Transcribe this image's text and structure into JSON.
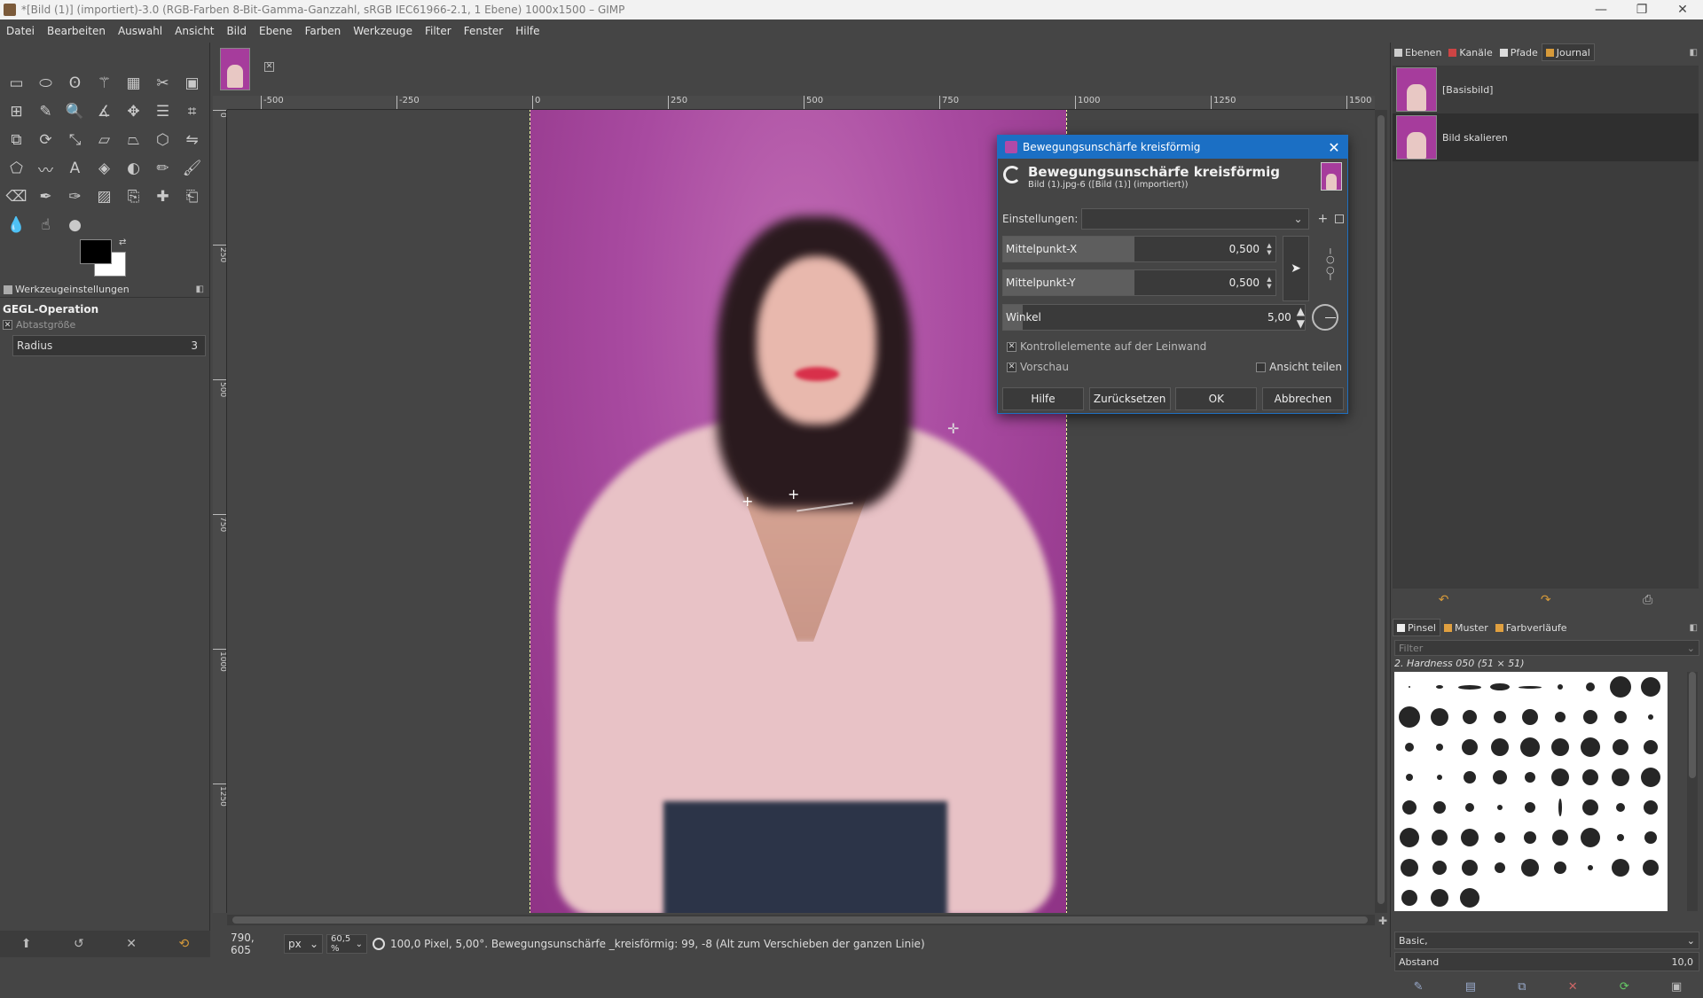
{
  "window": {
    "title": "*[Bild (1)] (importiert)-3.0 (RGB-Farben 8-Bit-Gamma-Ganzzahl, sRGB IEC61966-2.1, 1 Ebene) 1000x1500 – GIMP",
    "minimize": "—",
    "maximize": "❐",
    "close": "✕"
  },
  "menu": [
    "Datei",
    "Bearbeiten",
    "Auswahl",
    "Ansicht",
    "Bild",
    "Ebene",
    "Farben",
    "Werkzeuge",
    "Filter",
    "Fenster",
    "Hilfe"
  ],
  "toolbox": {
    "rows": [
      [
        "rect-select-icon",
        "ellipse-select-icon",
        "lasso-icon",
        "magic-wand-icon",
        "select-by-color-icon",
        "scissors-select-icon",
        "foreground-select-icon"
      ],
      [
        "align-icon",
        "paths-edit-icon",
        "zoom-icon",
        "measure-icon",
        "move-icon",
        "align-distribute-icon",
        "crop-icon"
      ],
      [
        "unified-transform-icon",
        "rotate-icon",
        "scale-icon",
        "shear-icon",
        "perspective-icon",
        "3d-transform-icon",
        "flip-icon"
      ],
      [
        "cage-icon",
        "warp-icon",
        "text-icon",
        "bucket-fill-icon",
        "gradient-icon",
        "pencil-icon",
        "paintbrush-icon"
      ],
      [
        "eraser-icon",
        "airbrush-icon",
        "ink-icon",
        "mypaint-icon",
        "clone-icon",
        "heal-icon",
        "perspective-clone-icon"
      ],
      [
        "blur-icon",
        "smudge-icon",
        "dodge-burn-icon"
      ]
    ],
    "glyphs": {
      "rect-select-icon": "▭",
      "ellipse-select-icon": "⬭",
      "lasso-icon": "ʘ",
      "magic-wand-icon": "⚚",
      "select-by-color-icon": "▦",
      "scissors-select-icon": "✂",
      "foreground-select-icon": "▣",
      "align-icon": "⊞",
      "paths-edit-icon": "✎",
      "zoom-icon": "🔍",
      "measure-icon": "∡",
      "move-icon": "✥",
      "align-distribute-icon": "☰",
      "crop-icon": "⌗",
      "unified-transform-icon": "⧉",
      "rotate-icon": "⟳",
      "scale-icon": "⤡",
      "shear-icon": "▱",
      "perspective-icon": "⏢",
      "3d-transform-icon": "⬡",
      "flip-icon": "⇋",
      "cage-icon": "⬠",
      "warp-icon": "〰",
      "text-icon": "A",
      "bucket-fill-icon": "◈",
      "gradient-icon": "◐",
      "pencil-icon": "✏",
      "paintbrush-icon": "🖌",
      "eraser-icon": "⌫",
      "airbrush-icon": "✒",
      "ink-icon": "✑",
      "mypaint-icon": "▨",
      "clone-icon": "⎘",
      "heal-icon": "✚",
      "perspective-clone-icon": "⎗",
      "blur-icon": "💧",
      "smudge-icon": "☝",
      "dodge-burn-icon": "●"
    }
  },
  "tool_options": {
    "tab_label": "Werkzeugeinstellungen",
    "section_title": "GEGL-Operation",
    "sample_size_label": "Abtastgröße",
    "radius_label": "Radius",
    "radius_value": "3"
  },
  "rulers": {
    "h": [
      "-500",
      "-250",
      "0",
      "250",
      "500",
      "750",
      "1000",
      "1250",
      "1500"
    ],
    "v": [
      "0",
      "250",
      "500",
      "750",
      "1000",
      "1250"
    ]
  },
  "status": {
    "coords": "790, 605",
    "unit": "px",
    "zoom": "60,5 %",
    "message": "100,0 Pixel, 5,00°. Bewegungsunschärfe _kreisförmig: 99, -8 (Alt zum Verschieben der ganzen Linie)"
  },
  "history": {
    "tabs": [
      "Ebenen",
      "Kanäle",
      "Pfade",
      "Journal"
    ],
    "items": [
      "[Basisbild]",
      "Bild skalieren"
    ]
  },
  "brushes": {
    "tabs": [
      "Pinsel",
      "Muster",
      "Farbverläufe"
    ],
    "filter_placeholder": "Filter",
    "selected_name": "2. Hardness 050 (51 × 51)",
    "set_label": "Basic,",
    "spacing_label": "Abstand",
    "spacing_value": "10,0"
  },
  "dialog": {
    "window_title": "Bewegungsunschärfe kreisförmig",
    "title": "Bewegungsunschärfe kreisförmig",
    "subtitle": "Bild (1).jpg-6 ([Bild (1)] (importiert))",
    "settings_label": "Einstellungen:",
    "center_x_label": "Mittelpunkt-X",
    "center_x_value": "0,500",
    "center_y_label": "Mittelpunkt-Y",
    "center_y_value": "0,500",
    "angle_label": "Winkel",
    "angle_value": "5,00",
    "canvas_controls_label": "Kontrollelemente auf der Leinwand",
    "canvas_controls_checked": true,
    "preview_label": "Vorschau",
    "preview_checked": true,
    "split_view_label": "Ansicht teilen",
    "split_view_checked": false,
    "buttons": {
      "help": "Hilfe",
      "reset": "Zurücksetzen",
      "ok": "OK",
      "cancel": "Abbrechen"
    }
  },
  "colors": {
    "accent": "#1b6fc4",
    "fg": "#000000",
    "bg": "#ffffff",
    "photo_bg": "#a84aa0"
  }
}
